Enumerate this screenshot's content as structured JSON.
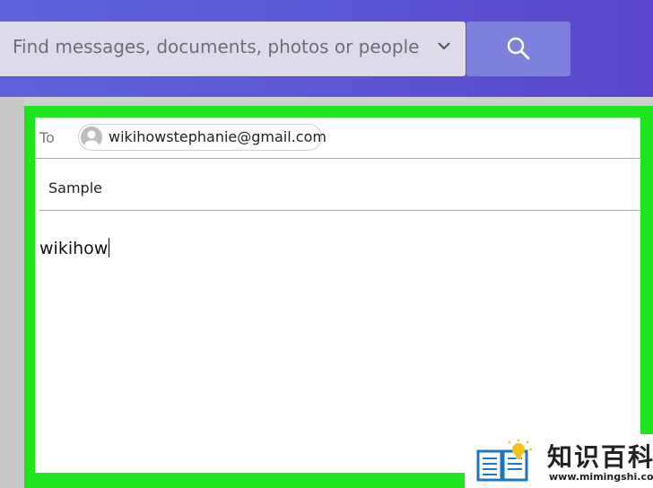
{
  "search": {
    "placeholder": "Find messages, documents, photos or people",
    "options_icon": "chevron-down-icon",
    "button_icon": "search-icon"
  },
  "compose": {
    "to_label": "To",
    "recipient": "wikihowstephanie@gmail.com",
    "recipient_icon": "avatar-placeholder-icon",
    "subject": "Sample",
    "body": "wikihow"
  },
  "watermark": {
    "title": "知识百科",
    "url": "www.mimingshi.com",
    "logo_icon": "book-lightbulb-icon"
  },
  "colors": {
    "header_gradient_start": "#5d63d9",
    "header_gradient_end": "#5a46cc",
    "search_button": "#7c80dc",
    "highlight": "#1ee51e",
    "watermark_accent": "#1d76c2"
  }
}
